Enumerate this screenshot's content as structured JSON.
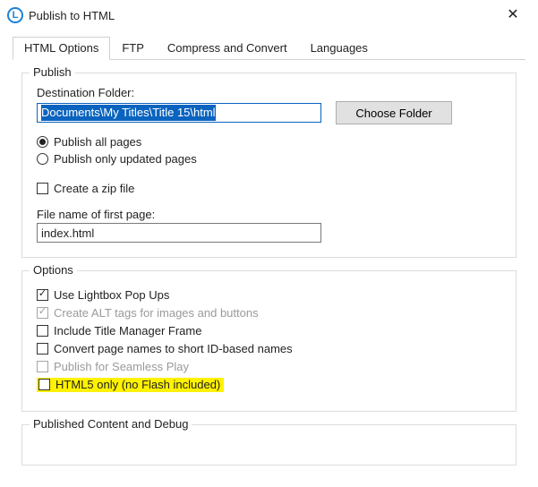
{
  "window": {
    "title": "Publish to HTML"
  },
  "tabs": [
    {
      "id": "html-options",
      "label": "HTML Options",
      "active": true
    },
    {
      "id": "ftp",
      "label": "FTP",
      "active": false
    },
    {
      "id": "compress",
      "label": "Compress and Convert",
      "active": false
    },
    {
      "id": "languages",
      "label": "Languages",
      "active": false
    }
  ],
  "publish": {
    "legend": "Publish",
    "destination_label": "Destination Folder:",
    "destination_value": "Documents\\My Titles\\Title 15\\html",
    "choose_folder_label": "Choose Folder",
    "radio_all_label": "Publish all pages",
    "radio_updated_label": "Publish only updated pages",
    "radio_selected": "all",
    "zip_label": "Create a zip file",
    "zip_checked": false,
    "firstpage_label": "File name of first page:",
    "firstpage_value": "index.html"
  },
  "options": {
    "legend": "Options",
    "items": [
      {
        "id": "lightbox",
        "label": "Use Lightbox Pop Ups",
        "checked": true,
        "disabled": false,
        "highlight": false
      },
      {
        "id": "alt-tags",
        "label": "Create ALT tags for images and buttons",
        "checked": true,
        "disabled": true,
        "highlight": false
      },
      {
        "id": "titlemgr",
        "label": "Include Title Manager Frame",
        "checked": false,
        "disabled": false,
        "highlight": false
      },
      {
        "id": "shortid",
        "label": "Convert page names to short ID-based names",
        "checked": false,
        "disabled": false,
        "highlight": false
      },
      {
        "id": "seamless",
        "label": "Publish for Seamless Play",
        "checked": false,
        "disabled": true,
        "highlight": false
      },
      {
        "id": "html5only",
        "label": "HTML5 only (no Flash included)",
        "checked": false,
        "disabled": false,
        "highlight": true
      }
    ]
  },
  "published_debug": {
    "legend": "Published Content and Debug"
  }
}
